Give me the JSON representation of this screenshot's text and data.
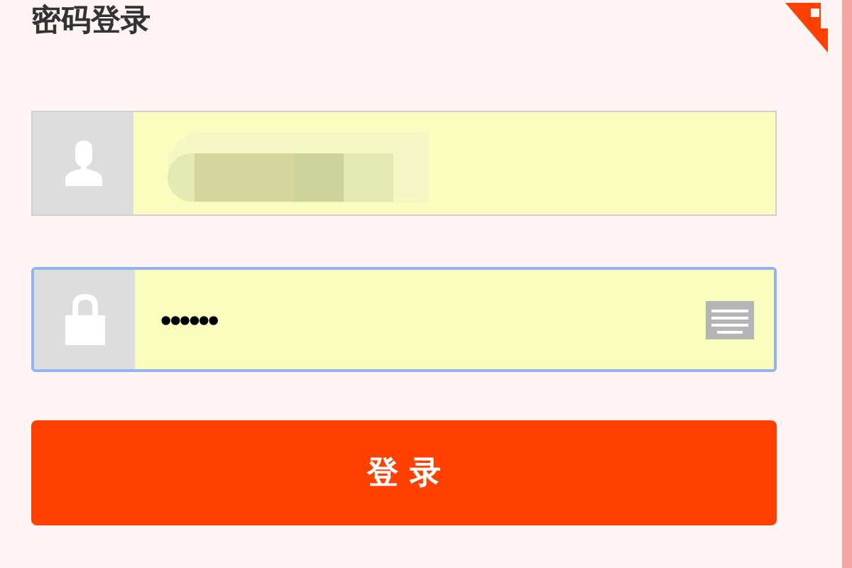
{
  "title": "密码登录",
  "fields": [
    {
      "kind": "username",
      "redacted": true,
      "focused": false
    },
    {
      "kind": "password",
      "value": "••••••",
      "focused": true
    }
  ],
  "login_button": {
    "label": "登 录"
  }
}
